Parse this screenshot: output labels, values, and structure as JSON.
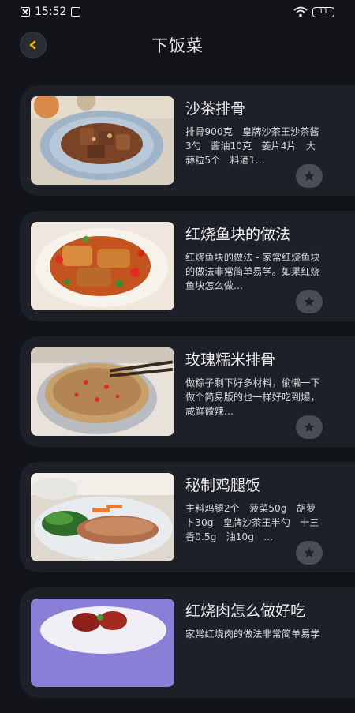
{
  "status_bar": {
    "time": "15:52",
    "battery": "11"
  },
  "header": {
    "title": "下饭菜"
  },
  "recipes": [
    {
      "title": "沙茶排骨",
      "description": "排骨900克　皇牌沙茶王沙茶酱3勺　酱油10克　姜片4片　大蒜粒5个　料酒1…"
    },
    {
      "title": "红烧鱼块的做法",
      "description": "红烧鱼块的做法 - 家常红烧鱼块的做法非常简单易学。如果红烧鱼块怎么做…"
    },
    {
      "title": "玫瑰糯米排骨",
      "description": "做粽子剩下好多材料，偷懒一下做个简易版的也一样好吃到爆，咸鲜微辣…"
    },
    {
      "title": "秘制鸡腿饭",
      "description": "主料鸡腿2个　菠菜50g　胡萝卜30g　皇牌沙茶王半勺　十三香0.5g　油10g　…"
    },
    {
      "title": "红烧肉怎么做好吃",
      "description": "家常红烧肉的做法非常简单易学"
    }
  ],
  "icons": {
    "back": "chevron-left-icon",
    "favorite": "star-icon"
  },
  "colors": {
    "background": "#12141a",
    "card": "#1d2027",
    "accent": "#f5b400"
  }
}
